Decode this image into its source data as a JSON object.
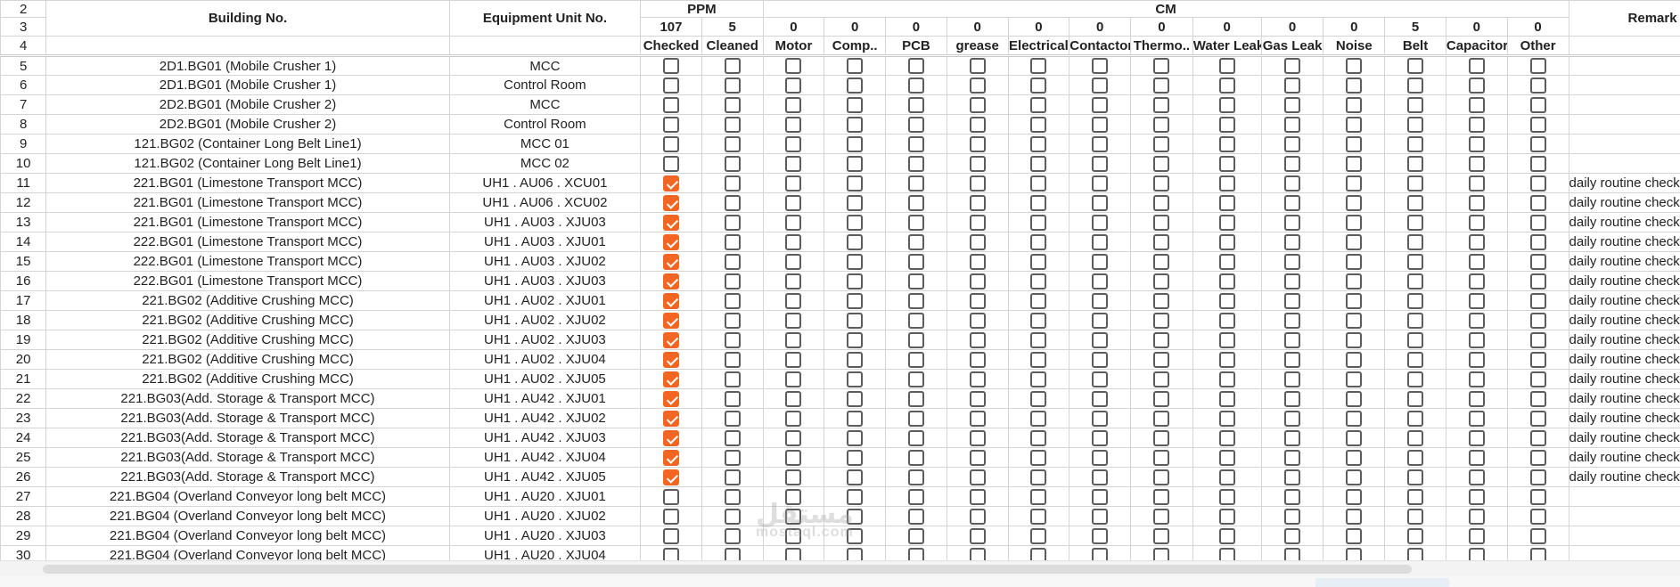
{
  "headers": {
    "building": "Building No.",
    "equipment": "Equipment Unit No.",
    "ppm": "PPM",
    "cm": "CM",
    "remarks": "Remark",
    "header_row_numbers": [
      "2",
      "3",
      "4"
    ],
    "counts": [
      "107",
      "5",
      "0",
      "0",
      "0",
      "0",
      "0",
      "0",
      "0",
      "0",
      "0",
      "0",
      "5",
      "0",
      "0"
    ],
    "subheaders": [
      "Checked",
      "Cleaned",
      "Motor",
      "Comp..",
      "PCB",
      "grease",
      "Electrical",
      "Contactor",
      "Thermo..",
      "Water Leak",
      "Gas Leak",
      "Noise",
      "Belt",
      "Capacitor",
      "Other"
    ]
  },
  "rows": [
    {
      "n": "5",
      "building": "2D1.BG01 (Mobile Crusher 1)",
      "equipment": "MCC",
      "checked": false,
      "remark": ""
    },
    {
      "n": "6",
      "building": "2D1.BG01 (Mobile Crusher 1)",
      "equipment": "Control Room",
      "checked": false,
      "remark": ""
    },
    {
      "n": "7",
      "building": "2D2.BG01 (Mobile Crusher 2)",
      "equipment": "MCC",
      "checked": false,
      "remark": ""
    },
    {
      "n": "8",
      "building": "2D2.BG01 (Mobile Crusher 2)",
      "equipment": "Control Room",
      "checked": false,
      "remark": ""
    },
    {
      "n": "9",
      "building": "121.BG02 (Container Long Belt Line1)",
      "equipment": "MCC 01",
      "checked": false,
      "remark": ""
    },
    {
      "n": "10",
      "building": "121.BG02 (Container Long Belt Line1)",
      "equipment": "MCC 02",
      "checked": false,
      "remark": ""
    },
    {
      "n": "11",
      "building": "221.BG01 (Limestone Transport MCC)",
      "equipment": "UH1 . AU06 . XCU01",
      "checked": true,
      "remark": "daily routine check a"
    },
    {
      "n": "12",
      "building": "221.BG01 (Limestone Transport MCC)",
      "equipment": "UH1 . AU06 . XCU02",
      "checked": true,
      "remark": "daily routine check a"
    },
    {
      "n": "13",
      "building": "221.BG01 (Limestone Transport MCC)",
      "equipment": "UH1 . AU03 . XJU03",
      "checked": true,
      "remark": "daily routine check a"
    },
    {
      "n": "14",
      "building": "222.BG01 (Limestone Transport MCC)",
      "equipment": "UH1 . AU03 . XJU01",
      "checked": true,
      "remark": "daily routine check a"
    },
    {
      "n": "15",
      "building": "222.BG01 (Limestone Transport MCC)",
      "equipment": "UH1 . AU03 . XJU02",
      "checked": true,
      "remark": "daily routine check a"
    },
    {
      "n": "16",
      "building": "222.BG01 (Limestone Transport MCC)",
      "equipment": "UH1 . AU03 . XJU03",
      "checked": true,
      "remark": "daily routine check a"
    },
    {
      "n": "17",
      "building": "221.BG02 (Additive Crushing MCC)",
      "equipment": "UH1 . AU02 . XJU01",
      "checked": true,
      "remark": "daily routine check a"
    },
    {
      "n": "18",
      "building": "221.BG02 (Additive Crushing MCC)",
      "equipment": "UH1 . AU02 . XJU02",
      "checked": true,
      "remark": "daily routine check a"
    },
    {
      "n": "19",
      "building": "221.BG02 (Additive Crushing MCC)",
      "equipment": "UH1 . AU02 . XJU03",
      "checked": true,
      "remark": "daily routine check a"
    },
    {
      "n": "20",
      "building": "221.BG02 (Additive Crushing MCC)",
      "equipment": "UH1 . AU02 . XJU04",
      "checked": true,
      "remark": "daily routine check a"
    },
    {
      "n": "21",
      "building": "221.BG02 (Additive Crushing MCC)",
      "equipment": "UH1 . AU02 . XJU05",
      "checked": true,
      "remark": "daily routine check a"
    },
    {
      "n": "22",
      "building": "221.BG03(Add. Storage & Transport MCC)",
      "equipment": "UH1 . AU42 . XJU01",
      "checked": true,
      "remark": "daily routine check a"
    },
    {
      "n": "23",
      "building": "221.BG03(Add. Storage & Transport MCC)",
      "equipment": "UH1 . AU42 . XJU02",
      "checked": true,
      "remark": "daily routine check a"
    },
    {
      "n": "24",
      "building": "221.BG03(Add. Storage & Transport MCC)",
      "equipment": "UH1 . AU42 . XJU03",
      "checked": true,
      "remark": "daily routine check a"
    },
    {
      "n": "25",
      "building": "221.BG03(Add. Storage & Transport MCC)",
      "equipment": "UH1 . AU42 . XJU04",
      "checked": true,
      "remark": "daily routine check a"
    },
    {
      "n": "26",
      "building": "221.BG03(Add. Storage & Transport MCC)",
      "equipment": "UH1 . AU42 . XJU05",
      "checked": true,
      "remark": "daily routine check a"
    },
    {
      "n": "27",
      "building": "221.BG04 (Overland Conveyor long belt MCC)",
      "equipment": "UH1 . AU20 . XJU01",
      "checked": false,
      "remark": ""
    },
    {
      "n": "28",
      "building": "221.BG04 (Overland Conveyor long belt MCC)",
      "equipment": "UH1 . AU20 . XJU02",
      "checked": false,
      "remark": ""
    },
    {
      "n": "29",
      "building": "221.BG04 (Overland Conveyor long belt MCC)",
      "equipment": "UH1 . AU20 . XJU03",
      "checked": false,
      "remark": ""
    },
    {
      "n": "30",
      "building": "221.BG04 (Overland Conveyor long belt MCC)",
      "equipment": "UH1 . AU20 . XJU04",
      "checked": false,
      "remark": ""
    }
  ],
  "watermark": {
    "line1": "مستقل",
    "line2": "mostaql.com"
  },
  "colors": {
    "accent": "#f26522",
    "grid": "#d4d4d4"
  }
}
